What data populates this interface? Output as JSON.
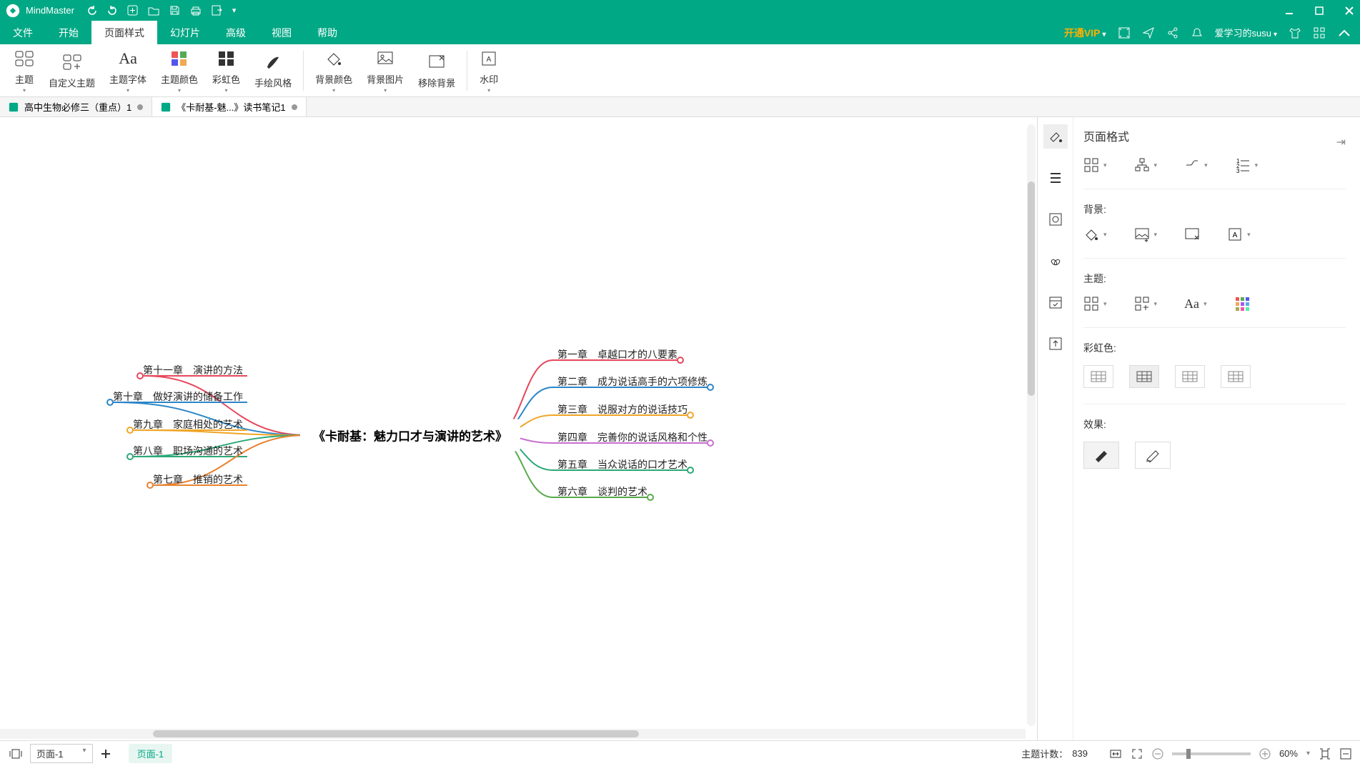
{
  "app": {
    "name": "MindMaster"
  },
  "menu": {
    "items": [
      "文件",
      "开始",
      "页面样式",
      "幻灯片",
      "高级",
      "视图",
      "帮助"
    ],
    "active_index": 2,
    "vip": "开通VIP",
    "user": "爱学习的susu"
  },
  "ribbon": {
    "buttons": [
      {
        "label": "主题",
        "drop": true
      },
      {
        "label": "自定义主题"
      },
      {
        "label": "主题字体",
        "drop": true
      },
      {
        "label": "主题颜色",
        "drop": true
      },
      {
        "label": "彩虹色",
        "drop": true
      },
      {
        "label": "手绘风格"
      },
      {
        "sep": true
      },
      {
        "label": "背景颜色",
        "drop": true
      },
      {
        "label": "背景图片",
        "drop": true
      },
      {
        "label": "移除背景"
      },
      {
        "sep": true
      },
      {
        "label": "水印",
        "drop": true
      }
    ]
  },
  "doctabs": [
    {
      "label": "高中生物必修三（重点）1",
      "active": false
    },
    {
      "label": "《卡耐基-魅...》读书笔记1",
      "active": true
    }
  ],
  "rightpane": {
    "title": "页面格式",
    "sections": {
      "background": "背景:",
      "theme": "主题:",
      "rainbow": "彩虹色:",
      "effect": "效果:"
    }
  },
  "mindmap": {
    "center": "《卡耐基：魅力口才与演讲的艺术》",
    "right": [
      {
        "label": "第一章　卓越口才的八要素",
        "color": "#e6485b"
      },
      {
        "label": "第二章　成为说话高手的六项修炼",
        "color": "#2b86c8"
      },
      {
        "label": "第三章　说服对方的说话技巧",
        "color": "#f0a527"
      },
      {
        "label": "第四章　完善你的说话风格和个性",
        "color": "#c86fd1"
      },
      {
        "label": "第五章　当众说话的口才艺术",
        "color": "#2ba877"
      },
      {
        "label": "第六章　谈判的艺术",
        "color": "#5aa84c"
      }
    ],
    "left": [
      {
        "label": "第十一章　演讲的方法",
        "color": "#e6485b"
      },
      {
        "label": "第十章　做好演讲的储备工作",
        "color": "#2b86c8"
      },
      {
        "label": "第九章　家庭相处的艺术",
        "color": "#f0a527"
      },
      {
        "label": "第八章　职场沟通的艺术",
        "color": "#2ba877"
      },
      {
        "label": "第七章　推销的艺术",
        "color": "#e88230"
      }
    ]
  },
  "status": {
    "page_selector": "页面-1",
    "page_chip": "页面-1",
    "topic_count_label": "主题计数：",
    "topic_count": "839",
    "zoom": "60%"
  }
}
